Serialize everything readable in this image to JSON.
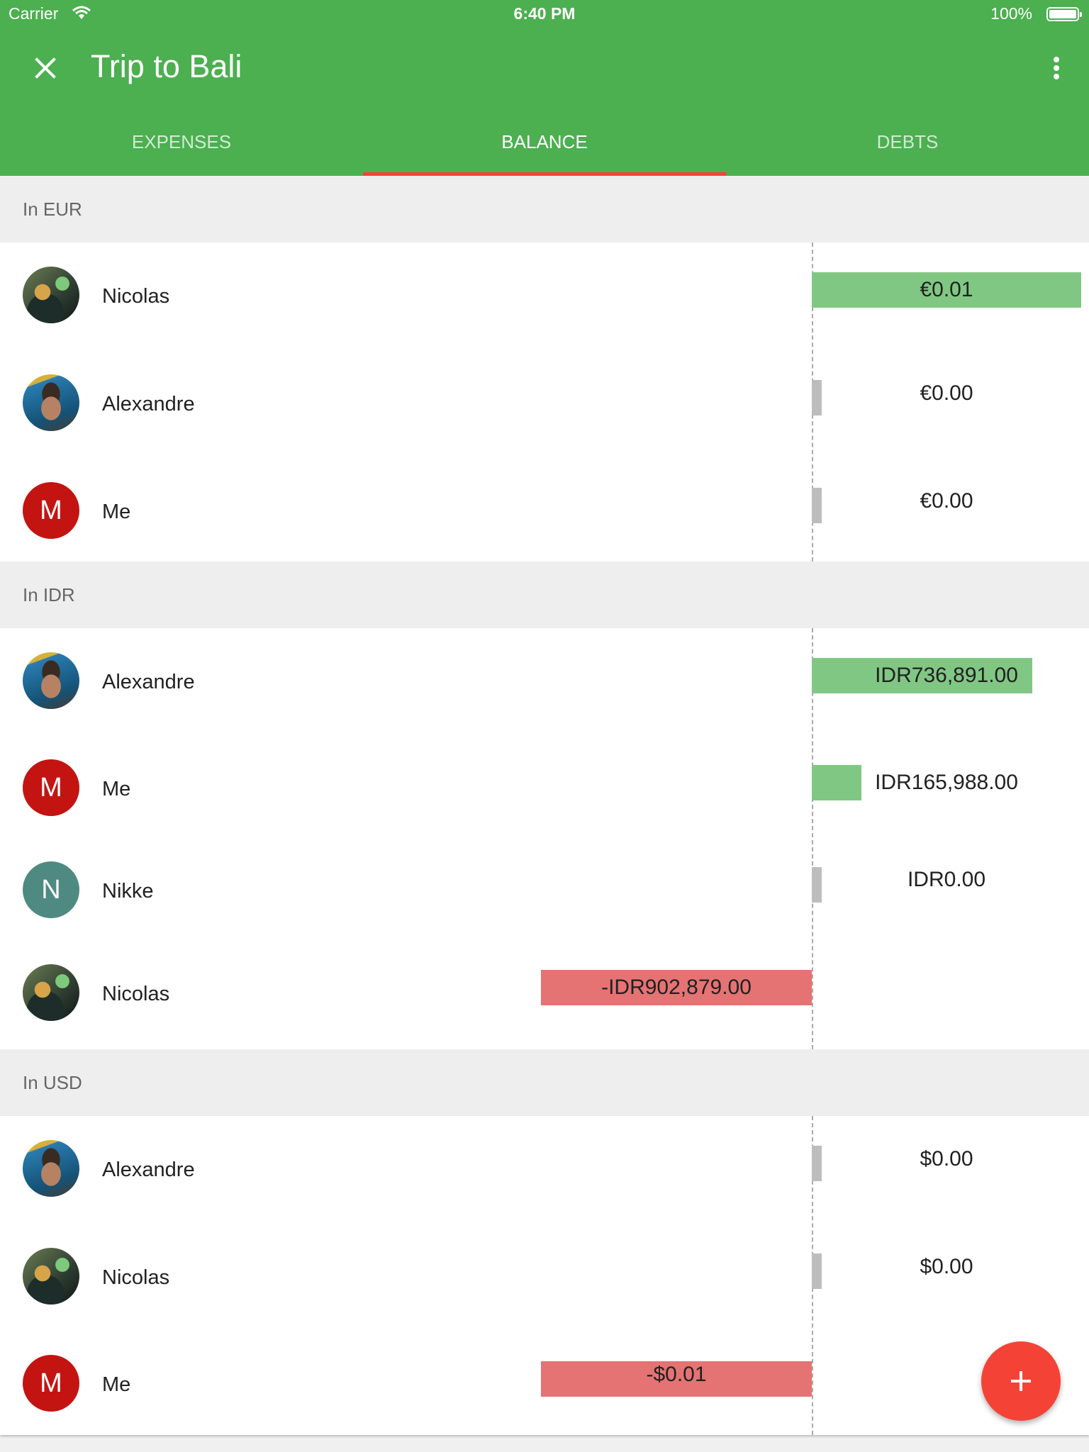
{
  "status_bar": {
    "carrier": "Carrier",
    "time": "6:40 PM",
    "battery": "100%"
  },
  "app_bar": {
    "title": "Trip to Bali",
    "close_icon": "close-icon",
    "more_icon": "more-vert-icon"
  },
  "tabs": [
    {
      "label": "EXPENSES",
      "active": false
    },
    {
      "label": "BALANCE",
      "active": true
    },
    {
      "label": "DEBTS",
      "active": false
    }
  ],
  "sections": [
    {
      "header": "In EUR",
      "rows": [
        {
          "name": "Nicolas",
          "avatar": "photo",
          "amount": "€0.01",
          "sign": "positive"
        },
        {
          "name": "Alexandre",
          "avatar": "photo",
          "amount": "€0.00",
          "sign": "zero"
        },
        {
          "name": "Me",
          "avatar": "M",
          "avatar_color": "#c41411",
          "amount": "€0.00",
          "sign": "zero"
        }
      ]
    },
    {
      "header": "In IDR",
      "rows": [
        {
          "name": "Alexandre",
          "avatar": "photo",
          "amount": "IDR736,891.00",
          "sign": "positive"
        },
        {
          "name": "Me",
          "avatar": "M",
          "avatar_color": "#c41411",
          "amount": "IDR165,988.00",
          "sign": "positive"
        },
        {
          "name": "Nikke",
          "avatar": "N",
          "avatar_color": "#4e8a82",
          "amount": "IDR0.00",
          "sign": "zero"
        },
        {
          "name": "Nicolas",
          "avatar": "photo",
          "amount": "-IDR902,879.00",
          "sign": "negative"
        }
      ]
    },
    {
      "header": "In USD",
      "rows": [
        {
          "name": "Alexandre",
          "avatar": "photo",
          "amount": "$0.00",
          "sign": "zero"
        },
        {
          "name": "Nicolas",
          "avatar": "photo",
          "amount": "$0.00",
          "sign": "zero"
        },
        {
          "name": "Me",
          "avatar": "M",
          "avatar_color": "#c41411",
          "amount": "-$0.01",
          "sign": "negative"
        }
      ]
    }
  ],
  "fab": {
    "icon": "add-icon"
  },
  "colors": {
    "app_bar": "#4caf50",
    "tab_indicator": "#f44336",
    "positive_bar": "#81c784",
    "negative_bar": "#e57373",
    "zero_bar": "#bdbdbd",
    "fab": "#f44336"
  }
}
